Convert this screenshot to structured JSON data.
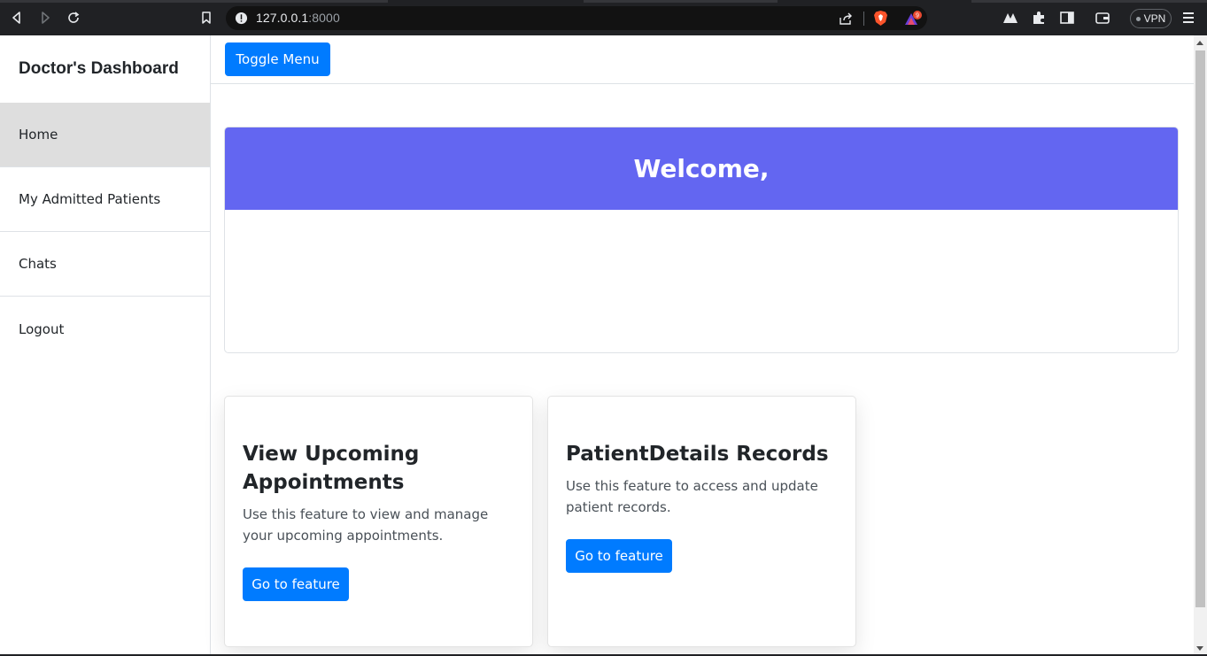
{
  "browser": {
    "url_host": "127.0.0.1",
    "url_port": ":8000",
    "vpn_label": "VPN",
    "rewards_badge": "9"
  },
  "sidebar": {
    "title": "Doctor's Dashboard",
    "items": [
      {
        "label": "Home",
        "active": true
      },
      {
        "label": "My Admitted Patients"
      },
      {
        "label": "Chats"
      },
      {
        "label": "Logout"
      }
    ]
  },
  "topnav": {
    "toggle_label": "Toggle Menu"
  },
  "welcome": {
    "title": "Welcome,"
  },
  "features": [
    {
      "title": "View Upcoming Appointments",
      "description": "Use this feature to view and manage your upcoming appointments.",
      "button_label": "Go to feature"
    },
    {
      "title": "PatientDetails Records",
      "description": "Use this feature to access and update patient records.",
      "button_label": "Go to feature"
    }
  ],
  "colors": {
    "primary": "#007bff",
    "welcome_header": "#6366f1",
    "active_sidebar": "#dedede"
  }
}
